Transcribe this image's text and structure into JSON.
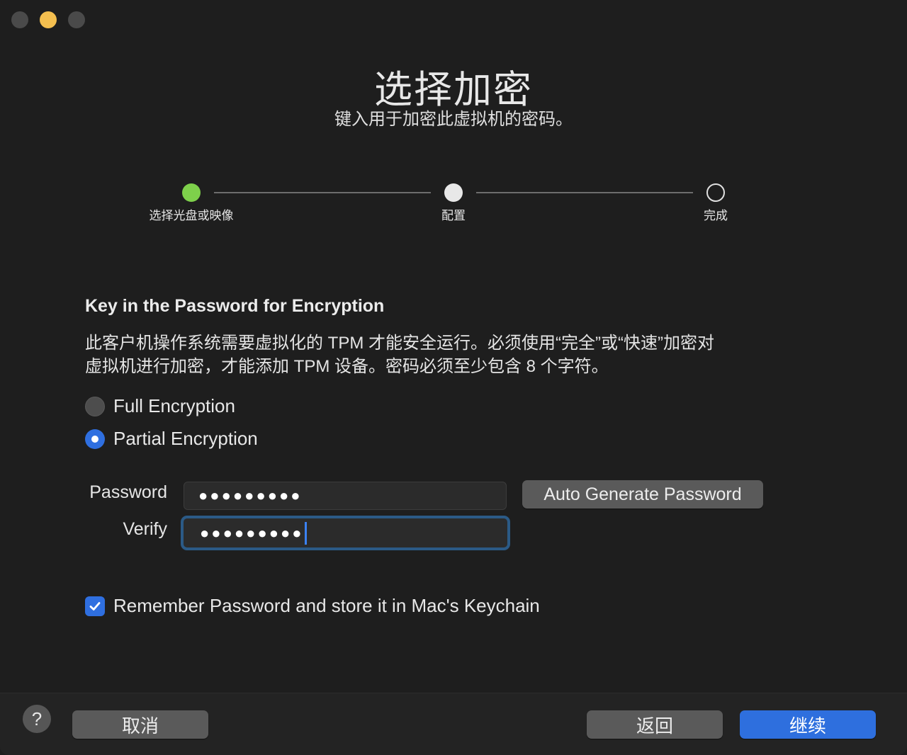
{
  "window": {
    "title": "选择加密",
    "subtitle": "键入用于加密此虚拟机的密码。"
  },
  "steps": [
    {
      "label": "选择光盘或映像",
      "state": "done"
    },
    {
      "label": "配置",
      "state": "current"
    },
    {
      "label": "完成",
      "state": "todo"
    }
  ],
  "section": {
    "title": "Key in the Password for Encryption",
    "description_line1": "此客户机操作系统需要虚拟化的 TPM 才能安全运行。必须使用“完全”或“快速”加密对",
    "description_line2": "虚拟机进行加密，才能添加 TPM 设备。密码必须至少包含 8 个字符。"
  },
  "encryption_options": [
    {
      "label": "Full Encryption",
      "selected": false
    },
    {
      "label": "Partial Encryption",
      "selected": true
    }
  ],
  "password": {
    "label": "Password",
    "value": "●●●●●●●●●"
  },
  "verify": {
    "label": "Verify",
    "value": "●●●●●●●●●"
  },
  "auto_generate_label": "Auto Generate Password",
  "keychain": {
    "label": "Remember Password and store it in Mac's Keychain",
    "checked": true
  },
  "footer": {
    "help_label": "?",
    "cancel_label": "取消",
    "back_label": "返回",
    "continue_label": "继续"
  },
  "colors": {
    "accent": "#2e6fde",
    "step_done": "#7ed04b",
    "minimize": "#f4bf4f"
  }
}
